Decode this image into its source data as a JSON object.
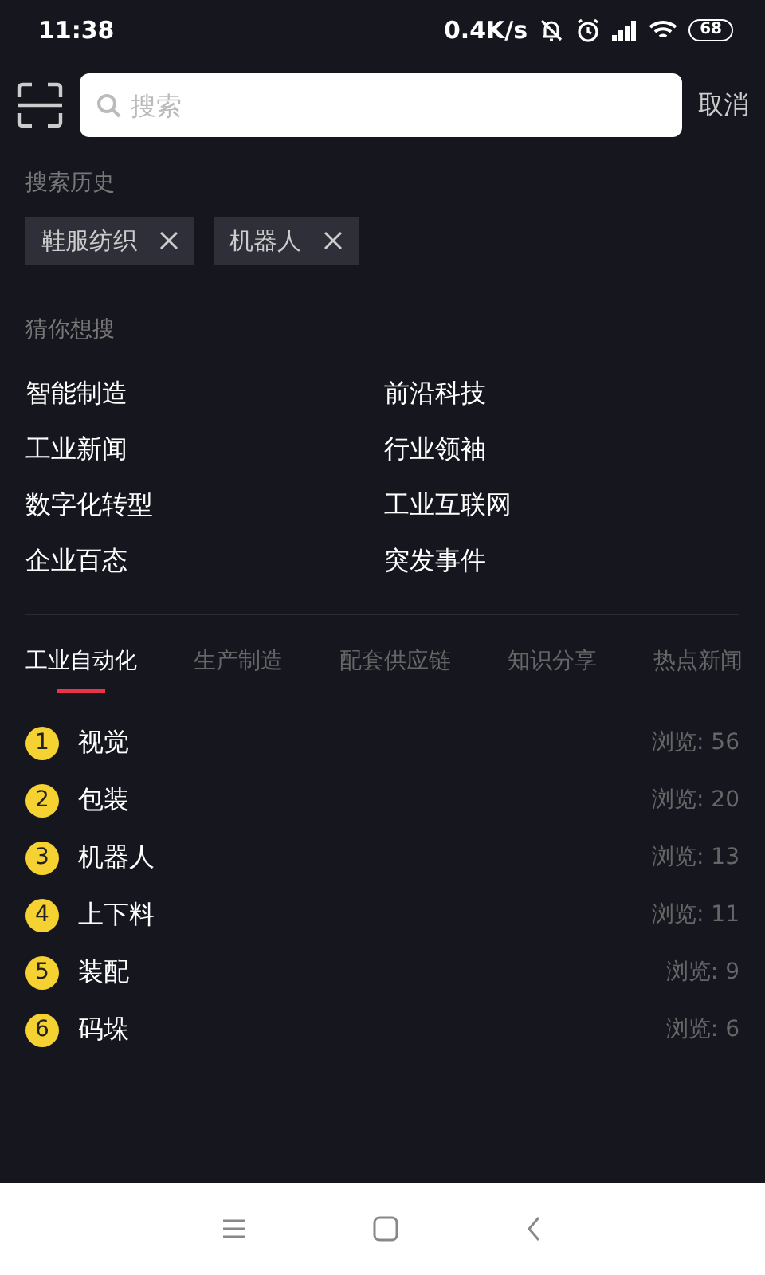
{
  "status_bar": {
    "time": "11:38",
    "speed": "0.4K/s",
    "battery": "68"
  },
  "search": {
    "placeholder": "搜索",
    "cancel": "取消"
  },
  "history": {
    "title": "搜索历史",
    "items": [
      "鞋服纺织",
      "机器人"
    ]
  },
  "suggestions": {
    "title": "猜你想搜",
    "items": [
      "智能制造",
      "前沿科技",
      "工业新闻",
      "行业领袖",
      "数字化转型",
      "工业互联网",
      "企业百态",
      "突发事件"
    ]
  },
  "tabs": [
    {
      "label": "工业自动化",
      "selected": true
    },
    {
      "label": "生产制造",
      "selected": false
    },
    {
      "label": "配套供应链",
      "selected": false
    },
    {
      "label": "知识分享",
      "selected": false
    },
    {
      "label": "热点新闻",
      "selected": false
    }
  ],
  "ranking": [
    {
      "rank": "1",
      "title": "视觉",
      "views": "浏览: 56"
    },
    {
      "rank": "2",
      "title": "包装",
      "views": "浏览: 20"
    },
    {
      "rank": "3",
      "title": "机器人",
      "views": "浏览: 13"
    },
    {
      "rank": "4",
      "title": "上下料",
      "views": "浏览: 11"
    },
    {
      "rank": "5",
      "title": "装配",
      "views": "浏览: 9"
    },
    {
      "rank": "6",
      "title": "码垛",
      "views": "浏览: 6"
    }
  ]
}
